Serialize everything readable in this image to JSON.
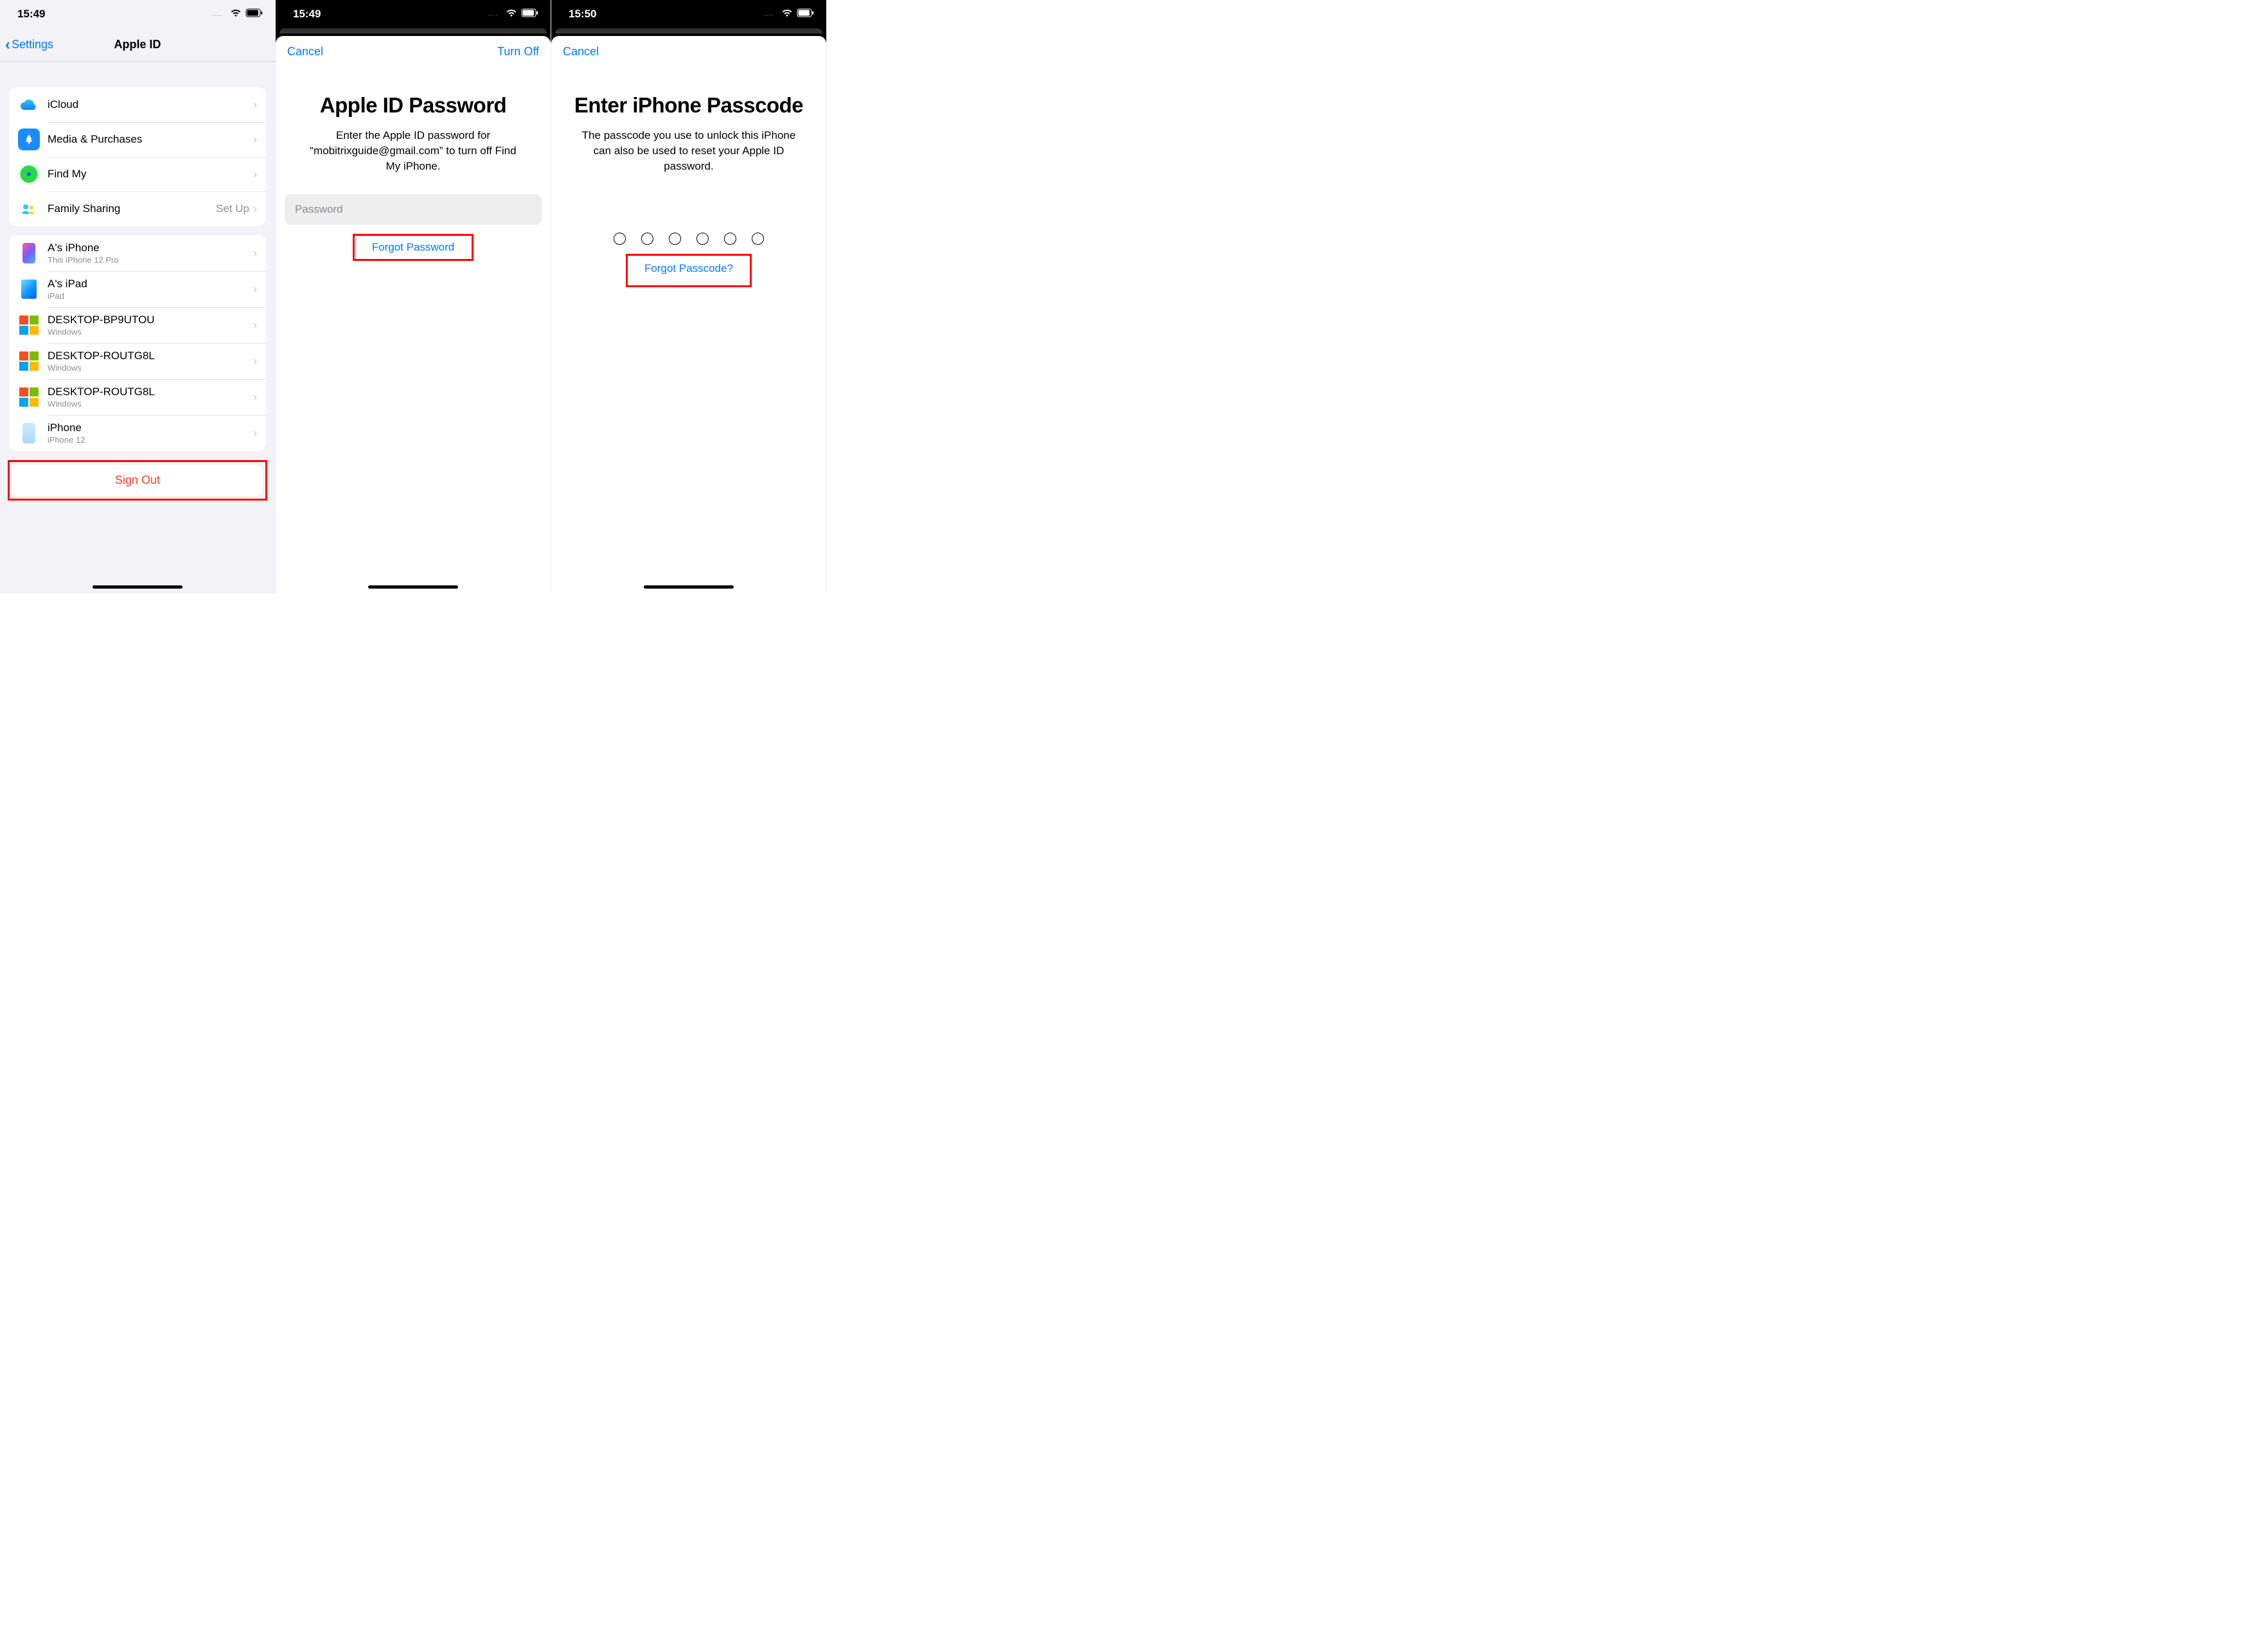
{
  "screen1": {
    "status_time": "15:49",
    "nav_back": "Settings",
    "nav_title": "Apple ID",
    "services": [
      {
        "label": "iCloud",
        "aside": ""
      },
      {
        "label": "Media & Purchases",
        "aside": ""
      },
      {
        "label": "Find My",
        "aside": ""
      },
      {
        "label": "Family Sharing",
        "aside": "Set Up"
      }
    ],
    "devices": [
      {
        "name": "A's iPhone",
        "sub": "This iPhone 12 Pro",
        "type": "phone"
      },
      {
        "name": "A's iPad",
        "sub": "iPad",
        "type": "ipad"
      },
      {
        "name": "DESKTOP-BP9UTOU",
        "sub": "Windows",
        "type": "win"
      },
      {
        "name": "DESKTOP-ROUTG8L",
        "sub": "Windows",
        "type": "win"
      },
      {
        "name": "DESKTOP-ROUTG8L",
        "sub": "Windows",
        "type": "win"
      },
      {
        "name": "iPhone",
        "sub": "iPhone 12",
        "type": "phone-plain"
      }
    ],
    "signout": "Sign Out"
  },
  "screen2": {
    "status_time": "15:49",
    "cancel": "Cancel",
    "turnoff": "Turn Off",
    "title": "Apple ID Password",
    "subtitle": "Enter the Apple ID password for “mobitrixguide@gmail.com” to turn off Find My iPhone.",
    "placeholder": "Password",
    "forgot": "Forgot Password"
  },
  "screen3": {
    "status_time": "15:50",
    "cancel": "Cancel",
    "title": "Enter iPhone Passcode",
    "subtitle": "The passcode you use to unlock this iPhone can also be used to reset your Apple ID password.",
    "forgot": "Forgot Passcode?"
  }
}
